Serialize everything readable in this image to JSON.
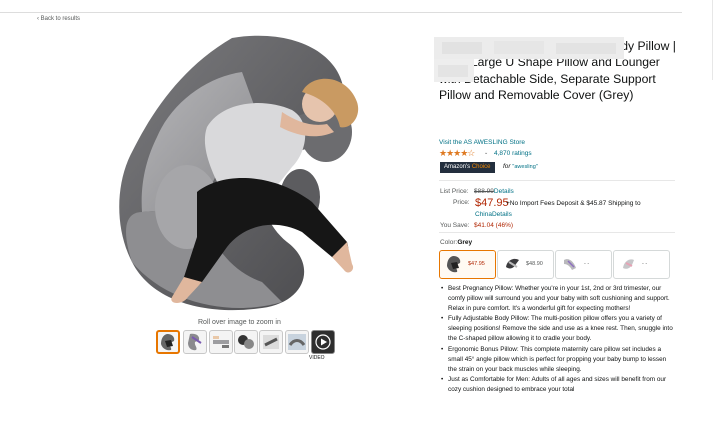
{
  "nav": {
    "back_label": "‹ Back to results"
  },
  "gallery": {
    "zoom_hint": "Roll over image to zoom in",
    "video_label": "VIDEO",
    "thumbnail_count": 7
  },
  "product": {
    "title": "and Pregnancy Body Pillow | Extra Large U Shape Pillow and Lounger with Detachable Side, Separate Support Pillow and Removable Cover (Grey)",
    "store_link": "Visit the AS AWESLING Store",
    "stars": 4.5,
    "stars_glyphs": "★★★★☆",
    "ratings": "4,870 ratings",
    "badge_prefix": "Amazon's",
    "badge_word": "Choice",
    "badge_for": "for",
    "badge_term": "\"awesling\""
  },
  "pricing": {
    "list_price_label": "List Price:",
    "list_price": "$88.99",
    "details_link": "Details",
    "price_label": "Price:",
    "price": "$47.95",
    "shipping_note": "+No Import Fees Deposit & $45.87 Shipping to",
    "shipping_dest": "China",
    "shipping_details": "Details",
    "save_label": "You Save:",
    "save_value": "$41.04 (46%)"
  },
  "variant": {
    "color_label": "Color:",
    "color_value": "Grey",
    "options": [
      {
        "price": "$47.95",
        "selected": true
      },
      {
        "price": "$48.90",
        "selected": false
      },
      {
        "price": "- -",
        "selected": false
      },
      {
        "price": "- -",
        "selected": false
      }
    ]
  },
  "bullets": [
    "Best Pregnancy Pillow: Whether you're in your 1st, 2nd or 3rd trimester, our comfy pillow will surround you and your baby with soft cushioning and support. Relax in pure comfort. It's a wonderful gift for expecting mothers!",
    "Fully Adjustable Body Pillow: The multi-position pillow offers you a variety of sleeping positions! Remove the side and use as a knee rest. Then, snuggle into the C-shaped pillow allowing it to cradle your body.",
    "Ergonomic Bonus Pillow: This complete maternity care pillow set includes a small 45° angle pillow which is perfect for propping your baby bump to lessen the strain on your back muscles while sleeping.",
    "Just as Comfortable for Men: Adults of all ages and sizes will benefit from our cozy cushion designed to embrace your total"
  ],
  "colors": {
    "link": "#007185",
    "price": "#b12704",
    "star": "#de7921",
    "selected_border": "#e77600",
    "badge_bg": "#232f3e",
    "pillow_dark": "#5f5f62",
    "pillow_light": "#9d9da0"
  }
}
